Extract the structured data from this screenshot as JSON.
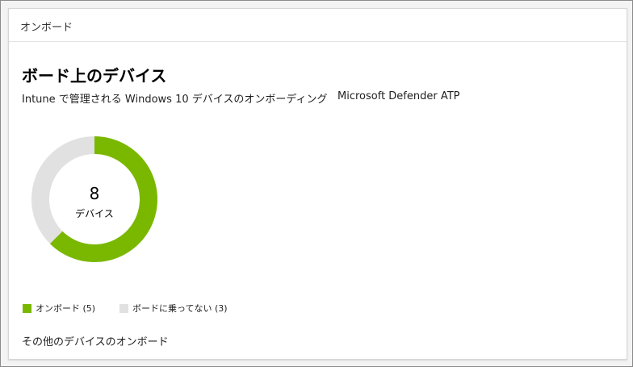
{
  "header": {
    "title": "オンボード"
  },
  "section": {
    "title": "ボード上のデバイス",
    "subtitle": "Intune で管理される Windows 10 デバイスのオンボーディング",
    "subtitle_right": "Microsoft Defender ATP"
  },
  "donut": {
    "center_value": "8",
    "center_label": "デバイス"
  },
  "chart_data": {
    "type": "pie",
    "donut": true,
    "total": 8,
    "slices": [
      {
        "label": "オンボード",
        "value": 5,
        "color": "#7ab800"
      },
      {
        "label": "ボードに乗ってない",
        "value": 3,
        "color": "#e1e1e1"
      }
    ]
  },
  "legend": {
    "items": [
      {
        "label": "オンボード (5)",
        "color": "#7ab800"
      },
      {
        "label": "ボードに乗ってない (3)",
        "color": "#e1e1e1"
      }
    ]
  },
  "footer": {
    "link_label": "その他のデバイスのオンボード"
  }
}
